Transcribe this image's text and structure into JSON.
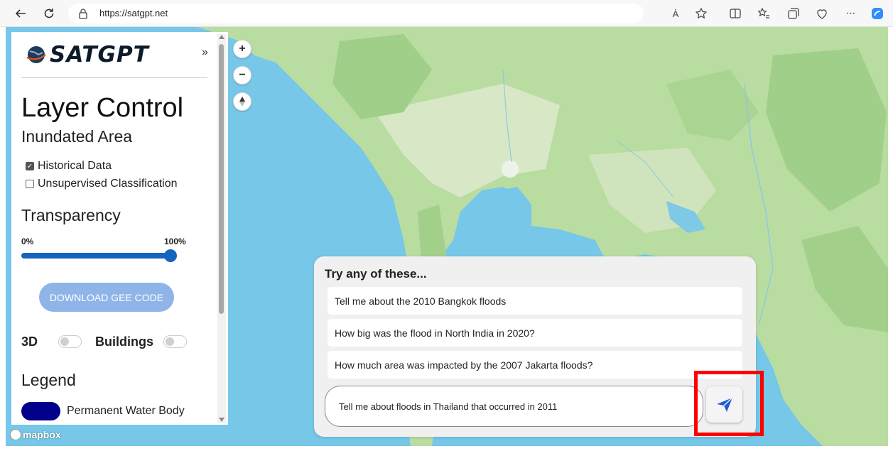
{
  "browser": {
    "url": "https://satgpt.net",
    "read_aloud": "À",
    "more": "···"
  },
  "panel": {
    "logo_text": "SATGPT",
    "collapse": "»",
    "title": "Layer Control",
    "subtitle": "Inundated Area",
    "checkboxes": [
      {
        "label": "Historical Data",
        "checked": true
      },
      {
        "label": "Unsupervised Classification",
        "checked": false
      }
    ],
    "transparency": {
      "title": "Transparency",
      "min_label": "0%",
      "max_label": "100%",
      "value": 1.0
    },
    "download_button": "DOWNLOAD GEE CODE",
    "toggles": [
      {
        "label": "3D",
        "on": false
      },
      {
        "label": "Buildings",
        "on": false
      }
    ],
    "legend": {
      "title": "Legend",
      "items": [
        {
          "label": "Permanent Water Body",
          "color": "#00008b"
        }
      ]
    }
  },
  "map": {
    "controls": {
      "zoom_in": "+",
      "zoom_out": "−"
    },
    "attribution": "mapbox",
    "water_color": "#76c7e8",
    "land_color": "#b9dca1"
  },
  "chat": {
    "title": "Try any of these...",
    "suggestions": [
      "Tell me about the 2010 Bangkok floods",
      "How big was the flood in North India in 2020?",
      "How much area was impacted by the 2007 Jakarta floods?"
    ],
    "input_value": "Tell me about floods in Thailand that occurred in 2011",
    "send_icon": "send-icon"
  },
  "highlight_color": "#ff0000"
}
